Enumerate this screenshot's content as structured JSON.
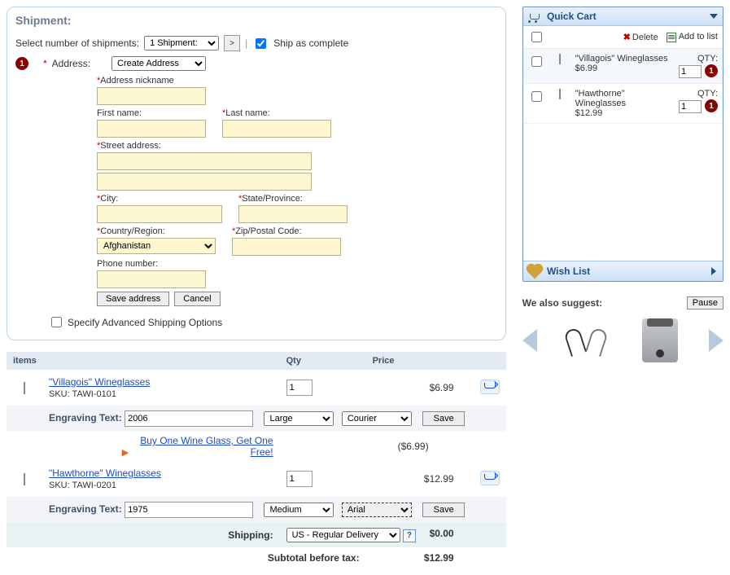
{
  "shipment": {
    "title": "Shipment:",
    "selectLabel": "Select number of shipments:",
    "shipmentsValue": "1 Shipment:",
    "go": ">",
    "shipComplete": "Ship as complete",
    "step1Badge": "1"
  },
  "address": {
    "label": "Address:",
    "selectValue": "Create Address",
    "nickname": "Address nickname",
    "firstName": "First name:",
    "lastName": "Last name:",
    "street": "Street address:",
    "city": "City:",
    "state": "State/Province:",
    "country": "Country/Region:",
    "countryValue": "Afghanistan",
    "zip": "Zip/Postal Code:",
    "phone": "Phone number:",
    "save": "Save address",
    "cancel": "Cancel"
  },
  "adv": {
    "label": "Specify Advanced Shipping Options"
  },
  "cols": {
    "items": "items",
    "qty": "Qty",
    "price": "Price"
  },
  "items": [
    {
      "name": "\"Villagois\" Wineglasses",
      "sku": "SKU: TAWI-0101",
      "qty": "1",
      "price": "$6.99",
      "engraveLabel": "Engraving Text:",
      "engraveText": "2006",
      "size": "Large",
      "font": "Courier",
      "promo": "Buy One Wine Glass, Get One Free!",
      "promoPrice": "($6.99)"
    },
    {
      "name": "\"Hawthorne\" Wineglasses",
      "sku": "SKU: TAWI-0201",
      "qty": "1",
      "price": "$12.99",
      "engraveLabel": "Engraving Text:",
      "engraveText": "1975",
      "size": "Medium",
      "font": "Arial"
    }
  ],
  "saveBtn": "Save",
  "shipping": {
    "label": "Shipping:",
    "method": "US - Regular Delivery",
    "help": "?",
    "amount": "$0.00"
  },
  "subtotal": {
    "label": "Subtotal before tax:",
    "amount": "$12.99"
  },
  "cart": {
    "title": "Quick Cart",
    "delete": "Delete",
    "addToList": "Add to list",
    "qtyLabel": "QTY:",
    "items": [
      {
        "name": "\"Villagois\" Wineglasses",
        "price": "$6.99",
        "qty": "1",
        "badge": "1"
      },
      {
        "name": "\"Hawthorne\" Wineglasses",
        "price": "$12.99",
        "qty": "1",
        "badge": "1"
      }
    ],
    "wishlist": "Wish List"
  },
  "suggest": {
    "title": "We also suggest:",
    "pause": "Pause"
  }
}
